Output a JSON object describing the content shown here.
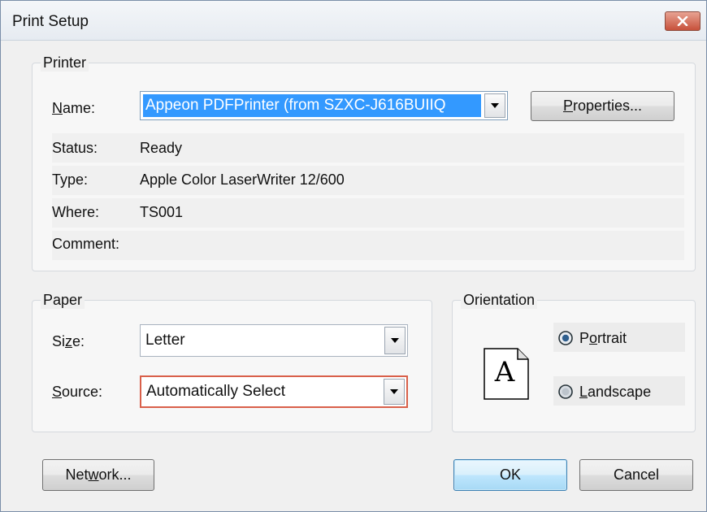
{
  "window": {
    "title": "Print Setup"
  },
  "printer": {
    "group_label": "Printer",
    "name_label_u": "N",
    "name_label_rest": "ame:",
    "name_value": "Appeon PDFPrinter (from SZXC-J616BUIIQ",
    "properties_u": "P",
    "properties_rest": "roperties...",
    "status_label": "Status:",
    "status_value": "Ready",
    "type_label": "Type:",
    "type_value": "Apple Color LaserWriter 12/600",
    "where_label": "Where:",
    "where_value": "TS001",
    "comment_label": "Comment:",
    "comment_value": ""
  },
  "paper": {
    "group_label": "Paper",
    "size_label_pre": "Si",
    "size_label_u": "z",
    "size_label_post": "e:",
    "size_value": "Letter",
    "source_label_u": "S",
    "source_label_rest": "ource:",
    "source_value": "Automatically Select"
  },
  "orientation": {
    "group_label": "Orientation",
    "page_glyph": "A",
    "portrait_pre": "P",
    "portrait_u": "o",
    "portrait_post": "rtrait",
    "portrait_selected": true,
    "landscape_u": "L",
    "landscape_rest": "andscape",
    "landscape_selected": false
  },
  "buttons": {
    "network_pre": "Net",
    "network_u": "w",
    "network_post": "ork...",
    "ok": "OK",
    "cancel": "Cancel"
  },
  "colors": {
    "selection": "#3399ff",
    "source_border": "#d9604a",
    "close_button": "#c7513b"
  }
}
